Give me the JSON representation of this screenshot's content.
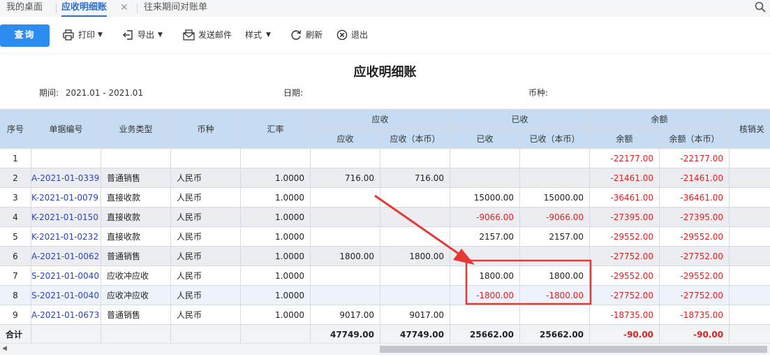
{
  "tabs": [
    {
      "label": "我的桌面"
    },
    {
      "label": "应收明细账"
    },
    {
      "label": "往来期间对账单"
    }
  ],
  "tab_close_glyph": "✕",
  "toolbar": {
    "query": "查询",
    "print": "打印",
    "export": "导出",
    "send_email": "发送邮件",
    "style": "样式",
    "refresh": "刷新",
    "exit": "退出"
  },
  "report": {
    "title": "应收明细账",
    "period_label": "期间:",
    "period_value": "2021.01 - 2021.01",
    "date_label": "日期:",
    "currency_label": "币种:"
  },
  "columns": {
    "seq": "序号",
    "doc_no": "单据编号",
    "biz_type": "业务类型",
    "currency": "币种",
    "rate": "汇率",
    "receivable_group": "应收",
    "receivable": "应收",
    "receivable_local": "应收（本币）",
    "received_group": "已收",
    "received": "已收",
    "received_local": "已收（本币）",
    "balance_group": "余额",
    "balance": "余额",
    "balance_local": "余额（本币）",
    "writeoff": "核销关"
  },
  "rows": [
    {
      "seq": "1",
      "doc": "",
      "type": "",
      "cur": "",
      "rate": "",
      "ar": "",
      "ar_l": "",
      "rc": "",
      "rc_l": "",
      "bal": "-22177.00",
      "bal_l": "-22177.00"
    },
    {
      "seq": "2",
      "doc": "A-2021-01-0339",
      "type": "普通销售",
      "cur": "人民币",
      "rate": "1.0000",
      "ar": "716.00",
      "ar_l": "716.00",
      "rc": "",
      "rc_l": "",
      "bal": "-21461.00",
      "bal_l": "-21461.00"
    },
    {
      "seq": "3",
      "doc": "K-2021-01-0079",
      "type": "直接收款",
      "cur": "人民币",
      "rate": "1.0000",
      "ar": "",
      "ar_l": "",
      "rc": "15000.00",
      "rc_l": "15000.00",
      "bal": "-36461.00",
      "bal_l": "-36461.00"
    },
    {
      "seq": "4",
      "doc": "K-2021-01-0150",
      "type": "直接收款",
      "cur": "人民币",
      "rate": "1.0000",
      "ar": "",
      "ar_l": "",
      "rc": "-9066.00",
      "rc_l": "-9066.00",
      "bal": "-27395.00",
      "bal_l": "-27395.00"
    },
    {
      "seq": "5",
      "doc": "K-2021-01-0232",
      "type": "直接收款",
      "cur": "人民币",
      "rate": "1.0000",
      "ar": "",
      "ar_l": "",
      "rc": "2157.00",
      "rc_l": "2157.00",
      "bal": "-29552.00",
      "bal_l": "-29552.00"
    },
    {
      "seq": "6",
      "doc": "A-2021-01-0062",
      "type": "普通销售",
      "cur": "人民币",
      "rate": "1.0000",
      "ar": "1800.00",
      "ar_l": "1800.00",
      "rc": "",
      "rc_l": "",
      "bal": "-27752.00",
      "bal_l": "-27752.00"
    },
    {
      "seq": "7",
      "doc": "S-2021-01-0040",
      "type": "应收冲应收",
      "cur": "人民币",
      "rate": "1.0000",
      "ar": "",
      "ar_l": "",
      "rc": "1800.00",
      "rc_l": "1800.00",
      "bal": "-29552.00",
      "bal_l": "-29552.00"
    },
    {
      "seq": "8",
      "doc": "S-2021-01-0040",
      "type": "应收冲应收",
      "cur": "人民币",
      "rate": "1.0000",
      "ar": "",
      "ar_l": "",
      "rc": "-1800.00",
      "rc_l": "-1800.00",
      "bal": "-27752.00",
      "bal_l": "-27752.00"
    },
    {
      "seq": "9",
      "doc": "A-2021-01-0673",
      "type": "普通销售",
      "cur": "人民币",
      "rate": "1.0000",
      "ar": "9017.00",
      "ar_l": "9017.00",
      "rc": "",
      "rc_l": "",
      "bal": "-18735.00",
      "bal_l": "-18735.00"
    }
  ],
  "total": {
    "label": "合计",
    "ar": "47749.00",
    "ar_l": "47749.00",
    "rc": "25662.00",
    "rc_l": "25662.00",
    "bal": "-90.00",
    "bal_l": "-90.00"
  },
  "colors": {
    "accent": "#2d8cf0",
    "header_bg": "#c6dcf3",
    "negative": "#e02020",
    "doc_link": "#2a45b8",
    "annotation": "#e53935"
  },
  "icons": [
    "search-icon",
    "print-icon",
    "export-icon",
    "email-icon",
    "refresh-icon",
    "exit-icon"
  ]
}
